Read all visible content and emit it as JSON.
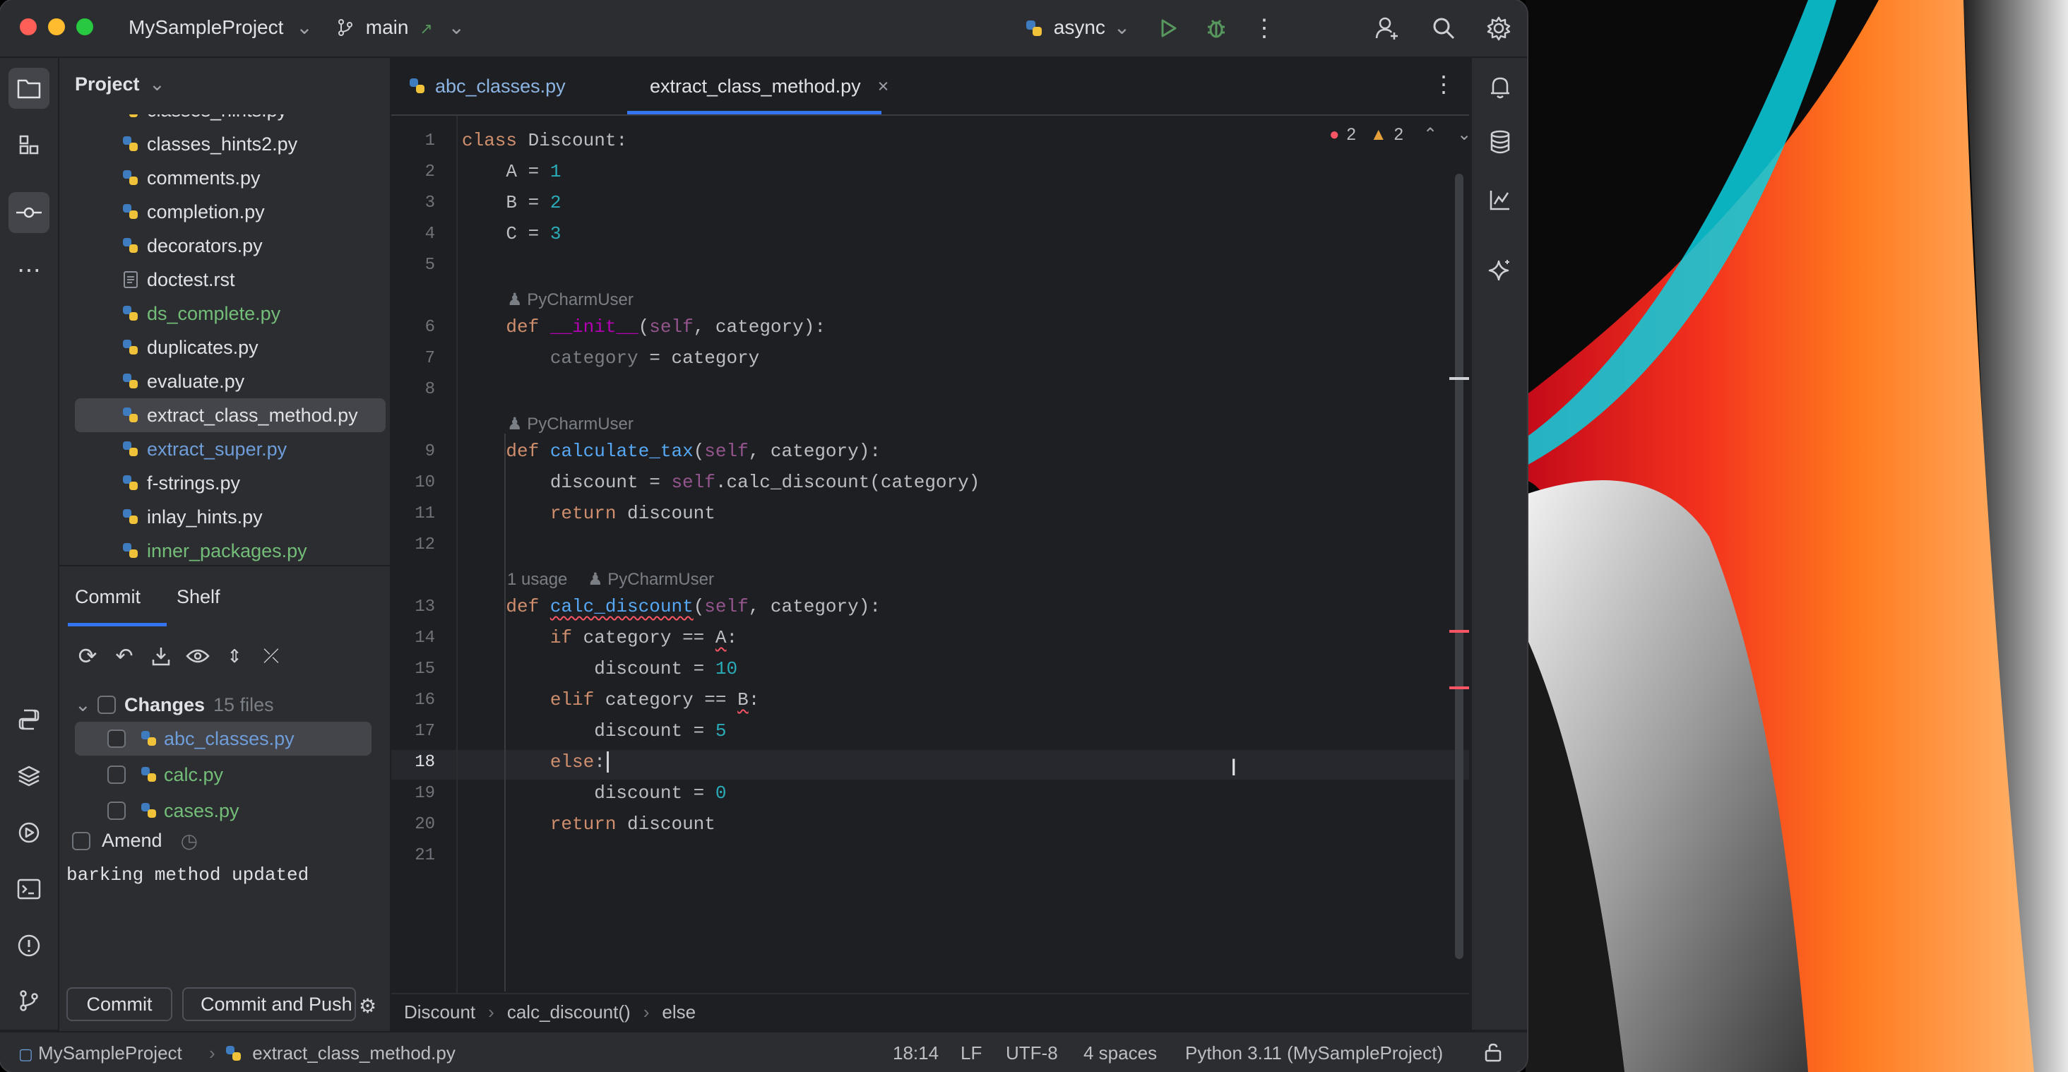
{
  "window": {
    "project_name": "MySampleProject",
    "branch": "main",
    "run_config": "async"
  },
  "project_panel": {
    "title": "Project",
    "files": [
      {
        "name": "classes_hints.py",
        "vc": "none"
      },
      {
        "name": "classes_hints2.py",
        "vc": "none"
      },
      {
        "name": "comments.py",
        "vc": "none"
      },
      {
        "name": "completion.py",
        "vc": "none"
      },
      {
        "name": "decorators.py",
        "vc": "none"
      },
      {
        "name": "doctest.rst",
        "vc": "none"
      },
      {
        "name": "ds_complete.py",
        "vc": "added"
      },
      {
        "name": "duplicates.py",
        "vc": "none"
      },
      {
        "name": "evaluate.py",
        "vc": "none"
      },
      {
        "name": "extract_class_method.py",
        "vc": "none",
        "selected": true
      },
      {
        "name": "extract_super.py",
        "vc": "modified"
      },
      {
        "name": "f-strings.py",
        "vc": "none"
      },
      {
        "name": "inlay_hints.py",
        "vc": "none"
      },
      {
        "name": "inner_packages.py",
        "vc": "added"
      }
    ]
  },
  "commit_panel": {
    "tabs": [
      "Commit",
      "Shelf"
    ],
    "changes_label": "Changes",
    "changes_count": "15 files",
    "changed_files": [
      {
        "name": "abc_classes.py",
        "color": "#6f9dd9"
      },
      {
        "name": "calc.py",
        "color": "#73bd79"
      },
      {
        "name": "cases.py",
        "color": "#73bd79"
      }
    ],
    "amend_label": "Amend",
    "message": "barking method updated",
    "commit_button": "Commit",
    "commit_push_button": "Commit and Push"
  },
  "editor": {
    "tabs": [
      {
        "name": "abc_classes.py",
        "active": false
      },
      {
        "name": "extract_class_method.py",
        "active": true
      }
    ],
    "errors": "2",
    "warnings": "2",
    "author": "PyCharmUser",
    "usage_hint": "1 usage",
    "line_numbers": [
      "1",
      "2",
      "3",
      "4",
      "5",
      "6",
      "7",
      "8",
      "9",
      "10",
      "11",
      "12",
      "13",
      "14",
      "15",
      "16",
      "17",
      "18",
      "19",
      "20",
      "21"
    ],
    "current_line": "18"
  },
  "breadcrumbs": [
    "Discount",
    "calc_discount()",
    "else"
  ],
  "status_bar": {
    "project": "MySampleProject",
    "file": "extract_class_method.py",
    "position": "18:14",
    "line_sep": "LF",
    "encoding": "UTF-8",
    "indent": "4 spaces",
    "interpreter": "Python 3.11 (MySampleProject)"
  },
  "colors": {
    "accent": "#3574f0",
    "error": "#f75464",
    "warning": "#e5a03c",
    "added": "#73bd79",
    "modified": "#6f9dd9"
  }
}
